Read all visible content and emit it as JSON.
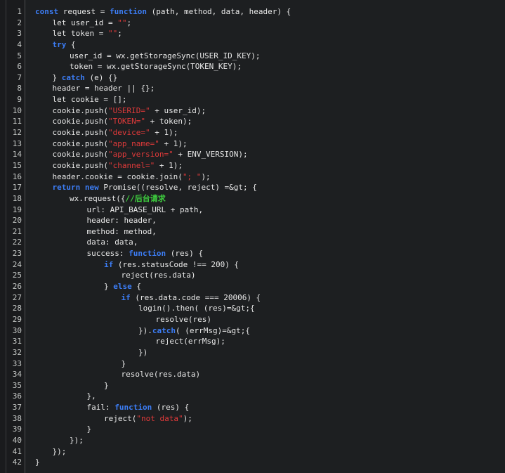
{
  "editor": {
    "theme_colors": {
      "background": "#1d1f21",
      "keyword": "#3c7df5",
      "string": "#e03a3a",
      "comment": "#3fd23f",
      "text": "#e8e8e8",
      "line_number": "#c5c8c6"
    },
    "lines": [
      {
        "num": "1",
        "indent": 0,
        "tokens": [
          [
            "kw",
            "const"
          ],
          [
            "tx",
            " request = "
          ],
          [
            "kw",
            "function"
          ],
          [
            "tx",
            " (path, method, data, header) {"
          ]
        ]
      },
      {
        "num": "2",
        "indent": 1,
        "tokens": [
          [
            "tx",
            "let user_id = "
          ],
          [
            "str",
            "\"\""
          ],
          [
            "tx",
            ";"
          ]
        ]
      },
      {
        "num": "3",
        "indent": 1,
        "tokens": [
          [
            "tx",
            "let token = "
          ],
          [
            "str",
            "\"\""
          ],
          [
            "tx",
            ";"
          ]
        ]
      },
      {
        "num": "4",
        "indent": 1,
        "tokens": [
          [
            "kw",
            "try"
          ],
          [
            "tx",
            " {"
          ]
        ]
      },
      {
        "num": "5",
        "indent": 2,
        "tokens": [
          [
            "tx",
            "user_id = wx.getStorageSync(USER_ID_KEY);"
          ]
        ]
      },
      {
        "num": "6",
        "indent": 2,
        "tokens": [
          [
            "tx",
            "token = wx.getStorageSync(TOKEN_KEY);"
          ]
        ]
      },
      {
        "num": "7",
        "indent": 1,
        "tokens": [
          [
            "tx",
            "} "
          ],
          [
            "kw",
            "catch"
          ],
          [
            "tx",
            " (e) {}"
          ]
        ]
      },
      {
        "num": "8",
        "indent": 1,
        "tokens": [
          [
            "tx",
            "header = header || {};"
          ]
        ]
      },
      {
        "num": "9",
        "indent": 1,
        "tokens": [
          [
            "tx",
            "let cookie = [];"
          ]
        ]
      },
      {
        "num": "10",
        "indent": 1,
        "tokens": [
          [
            "tx",
            "cookie.push("
          ],
          [
            "str",
            "\"USERID=\""
          ],
          [
            "tx",
            " + user_id);"
          ]
        ]
      },
      {
        "num": "11",
        "indent": 1,
        "tokens": [
          [
            "tx",
            "cookie.push("
          ],
          [
            "str",
            "\"TOKEN=\""
          ],
          [
            "tx",
            " + token);"
          ]
        ]
      },
      {
        "num": "12",
        "indent": 1,
        "tokens": [
          [
            "tx",
            "cookie.push("
          ],
          [
            "str",
            "\"device=\""
          ],
          [
            "tx",
            " + 1);"
          ]
        ]
      },
      {
        "num": "13",
        "indent": 1,
        "tokens": [
          [
            "tx",
            "cookie.push("
          ],
          [
            "str",
            "\"app_name=\""
          ],
          [
            "tx",
            " + 1);"
          ]
        ]
      },
      {
        "num": "14",
        "indent": 1,
        "tokens": [
          [
            "tx",
            "cookie.push("
          ],
          [
            "str",
            "\"app_version=\""
          ],
          [
            "tx",
            " + ENV_VERSION);"
          ]
        ]
      },
      {
        "num": "15",
        "indent": 1,
        "tokens": [
          [
            "tx",
            "cookie.push("
          ],
          [
            "str",
            "\"channel=\""
          ],
          [
            "tx",
            " + 1);"
          ]
        ]
      },
      {
        "num": "16",
        "indent": 1,
        "tokens": [
          [
            "tx",
            "header.cookie = cookie.join("
          ],
          [
            "str",
            "\"; \""
          ],
          [
            "tx",
            ");"
          ]
        ]
      },
      {
        "num": "17",
        "indent": 1,
        "tokens": [
          [
            "kw",
            "return"
          ],
          [
            "tx",
            " "
          ],
          [
            "kw",
            "new"
          ],
          [
            "tx",
            " Promise((resolve, reject) =&gt; {"
          ]
        ]
      },
      {
        "num": "18",
        "indent": 2,
        "tokens": [
          [
            "tx",
            "wx.request({"
          ],
          [
            "cm",
            "//后台请求"
          ]
        ]
      },
      {
        "num": "19",
        "indent": 3,
        "tokens": [
          [
            "tx",
            "url: API_BASE_URL + path,"
          ]
        ]
      },
      {
        "num": "20",
        "indent": 3,
        "tokens": [
          [
            "tx",
            "header: header,"
          ]
        ]
      },
      {
        "num": "21",
        "indent": 3,
        "tokens": [
          [
            "tx",
            "method: method,"
          ]
        ]
      },
      {
        "num": "22",
        "indent": 3,
        "tokens": [
          [
            "tx",
            "data: data,"
          ]
        ]
      },
      {
        "num": "23",
        "indent": 3,
        "tokens": [
          [
            "tx",
            "success: "
          ],
          [
            "kw",
            "function"
          ],
          [
            "tx",
            " (res) {"
          ]
        ]
      },
      {
        "num": "24",
        "indent": 4,
        "tokens": [
          [
            "kw",
            "if"
          ],
          [
            "tx",
            " (res.statusCode !== 200) {"
          ]
        ]
      },
      {
        "num": "25",
        "indent": 5,
        "tokens": [
          [
            "tx",
            "reject(res.data)"
          ]
        ]
      },
      {
        "num": "26",
        "indent": 4,
        "tokens": [
          [
            "tx",
            "} "
          ],
          [
            "kw",
            "else"
          ],
          [
            "tx",
            " {"
          ]
        ]
      },
      {
        "num": "27",
        "indent": 5,
        "tokens": [
          [
            "kw",
            "if"
          ],
          [
            "tx",
            " (res.data.code === 20006) {"
          ]
        ]
      },
      {
        "num": "28",
        "indent": 6,
        "tokens": [
          [
            "tx",
            "login().then( (res)=&gt;{"
          ]
        ]
      },
      {
        "num": "29",
        "indent": 7,
        "tokens": [
          [
            "tx",
            "resolve(res)"
          ]
        ]
      },
      {
        "num": "30",
        "indent": 6,
        "tokens": [
          [
            "tx",
            "})."
          ],
          [
            "kw",
            "catch"
          ],
          [
            "tx",
            "( (errMsg)=&gt;{"
          ]
        ]
      },
      {
        "num": "31",
        "indent": 7,
        "tokens": [
          [
            "tx",
            "reject(errMsg);"
          ]
        ]
      },
      {
        "num": "32",
        "indent": 6,
        "tokens": [
          [
            "tx",
            "})"
          ]
        ]
      },
      {
        "num": "33",
        "indent": 5,
        "tokens": [
          [
            "tx",
            "}"
          ]
        ]
      },
      {
        "num": "34",
        "indent": 5,
        "tokens": [
          [
            "tx",
            "resolve(res.data)"
          ]
        ]
      },
      {
        "num": "35",
        "indent": 4,
        "tokens": [
          [
            "tx",
            "}"
          ]
        ]
      },
      {
        "num": "36",
        "indent": 3,
        "tokens": [
          [
            "tx",
            "},"
          ]
        ]
      },
      {
        "num": "37",
        "indent": 3,
        "tokens": [
          [
            "tx",
            "fail: "
          ],
          [
            "kw",
            "function"
          ],
          [
            "tx",
            " (res) {"
          ]
        ]
      },
      {
        "num": "38",
        "indent": 4,
        "tokens": [
          [
            "tx",
            "reject("
          ],
          [
            "str",
            "\"not data\""
          ],
          [
            "tx",
            ");"
          ]
        ]
      },
      {
        "num": "39",
        "indent": 3,
        "tokens": [
          [
            "tx",
            "}"
          ]
        ]
      },
      {
        "num": "40",
        "indent": 2,
        "tokens": [
          [
            "tx",
            "});"
          ]
        ]
      },
      {
        "num": "41",
        "indent": 1,
        "tokens": [
          [
            "tx",
            "});"
          ]
        ]
      },
      {
        "num": "42",
        "indent": 0,
        "tokens": [
          [
            "tx",
            "}"
          ]
        ]
      }
    ]
  }
}
